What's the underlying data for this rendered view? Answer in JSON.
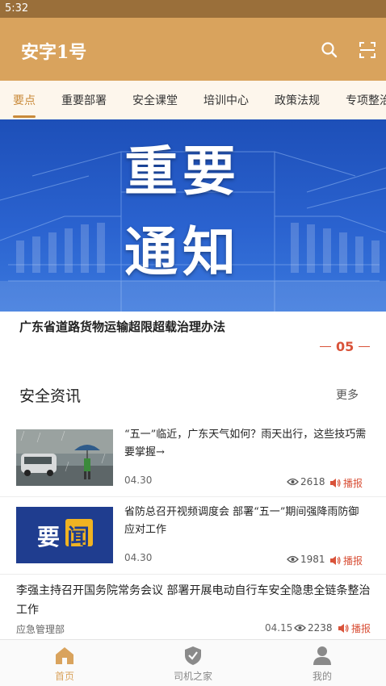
{
  "status_bar": {
    "time": "5:32"
  },
  "app_bar": {
    "title": "安字1号"
  },
  "tabs": [
    {
      "label": "要点",
      "active": true
    },
    {
      "label": "重要部署"
    },
    {
      "label": "安全课堂"
    },
    {
      "label": "培训中心"
    },
    {
      "label": "政策法规"
    },
    {
      "label": "专项整治"
    }
  ],
  "banner": {
    "line1": "重要",
    "line2": "通知",
    "caption": "广东省道路货物运输超限超载治理办法",
    "page_indicator": "05"
  },
  "section": {
    "title": "安全资讯",
    "more": "更多"
  },
  "news": [
    {
      "title": "“五一”临近，广东天气如何？雨天出行，这些技巧需要掌握→",
      "date": "04.30",
      "views": "2618",
      "play_label": "播报",
      "thumb": "rain-street-photo"
    },
    {
      "title": "省防总召开视频调度会 部署“五一”期间强降雨防御应对工作",
      "date": "04.30",
      "views": "1981",
      "play_label": "播报",
      "thumb": "important-news-graphic",
      "thumb_text": {
        "left": "要",
        "right": "闻"
      }
    },
    {
      "title": "李强主持召开国务院常务会议 部署开展电动自行车安全隐患全链条整治工作",
      "source": "应急管理部",
      "date": "04.15",
      "views": "2238",
      "play_label": "播报"
    }
  ],
  "bottom_nav": [
    {
      "label": "首页",
      "icon": "home-icon",
      "active": true
    },
    {
      "label": "司机之家",
      "icon": "shield-check-icon"
    },
    {
      "label": "我的",
      "icon": "user-icon"
    }
  ],
  "colors": {
    "accent": "#d9a35d",
    "status_bar": "#9a6f3a",
    "banner_blue": "#2a62cf",
    "play_red": "#d9533a"
  }
}
